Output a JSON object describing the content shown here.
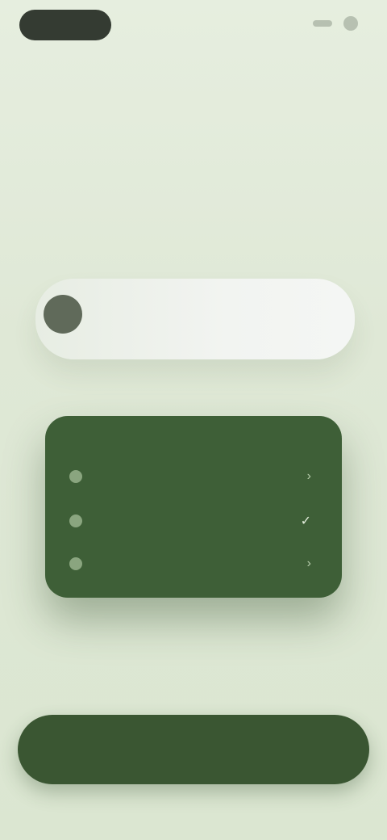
{
  "header": {
    "brand_label": "",
    "icons": [
      "menu-icon",
      "profile-icon"
    ]
  },
  "hero": {
    "title": "",
    "subtitle": ""
  },
  "preview_card": {
    "line_1": "",
    "line_2": ""
  },
  "plan_card": {
    "title": "",
    "items": [
      {
        "label": "",
        "state": "inactive"
      },
      {
        "label": "",
        "state": "active"
      },
      {
        "label": "",
        "state": "inactive"
      }
    ]
  },
  "cta": {
    "label": ""
  },
  "colors": {
    "background": "#dfe8d6",
    "accent": "#3e5f37",
    "brand_pill": "#343b32"
  }
}
